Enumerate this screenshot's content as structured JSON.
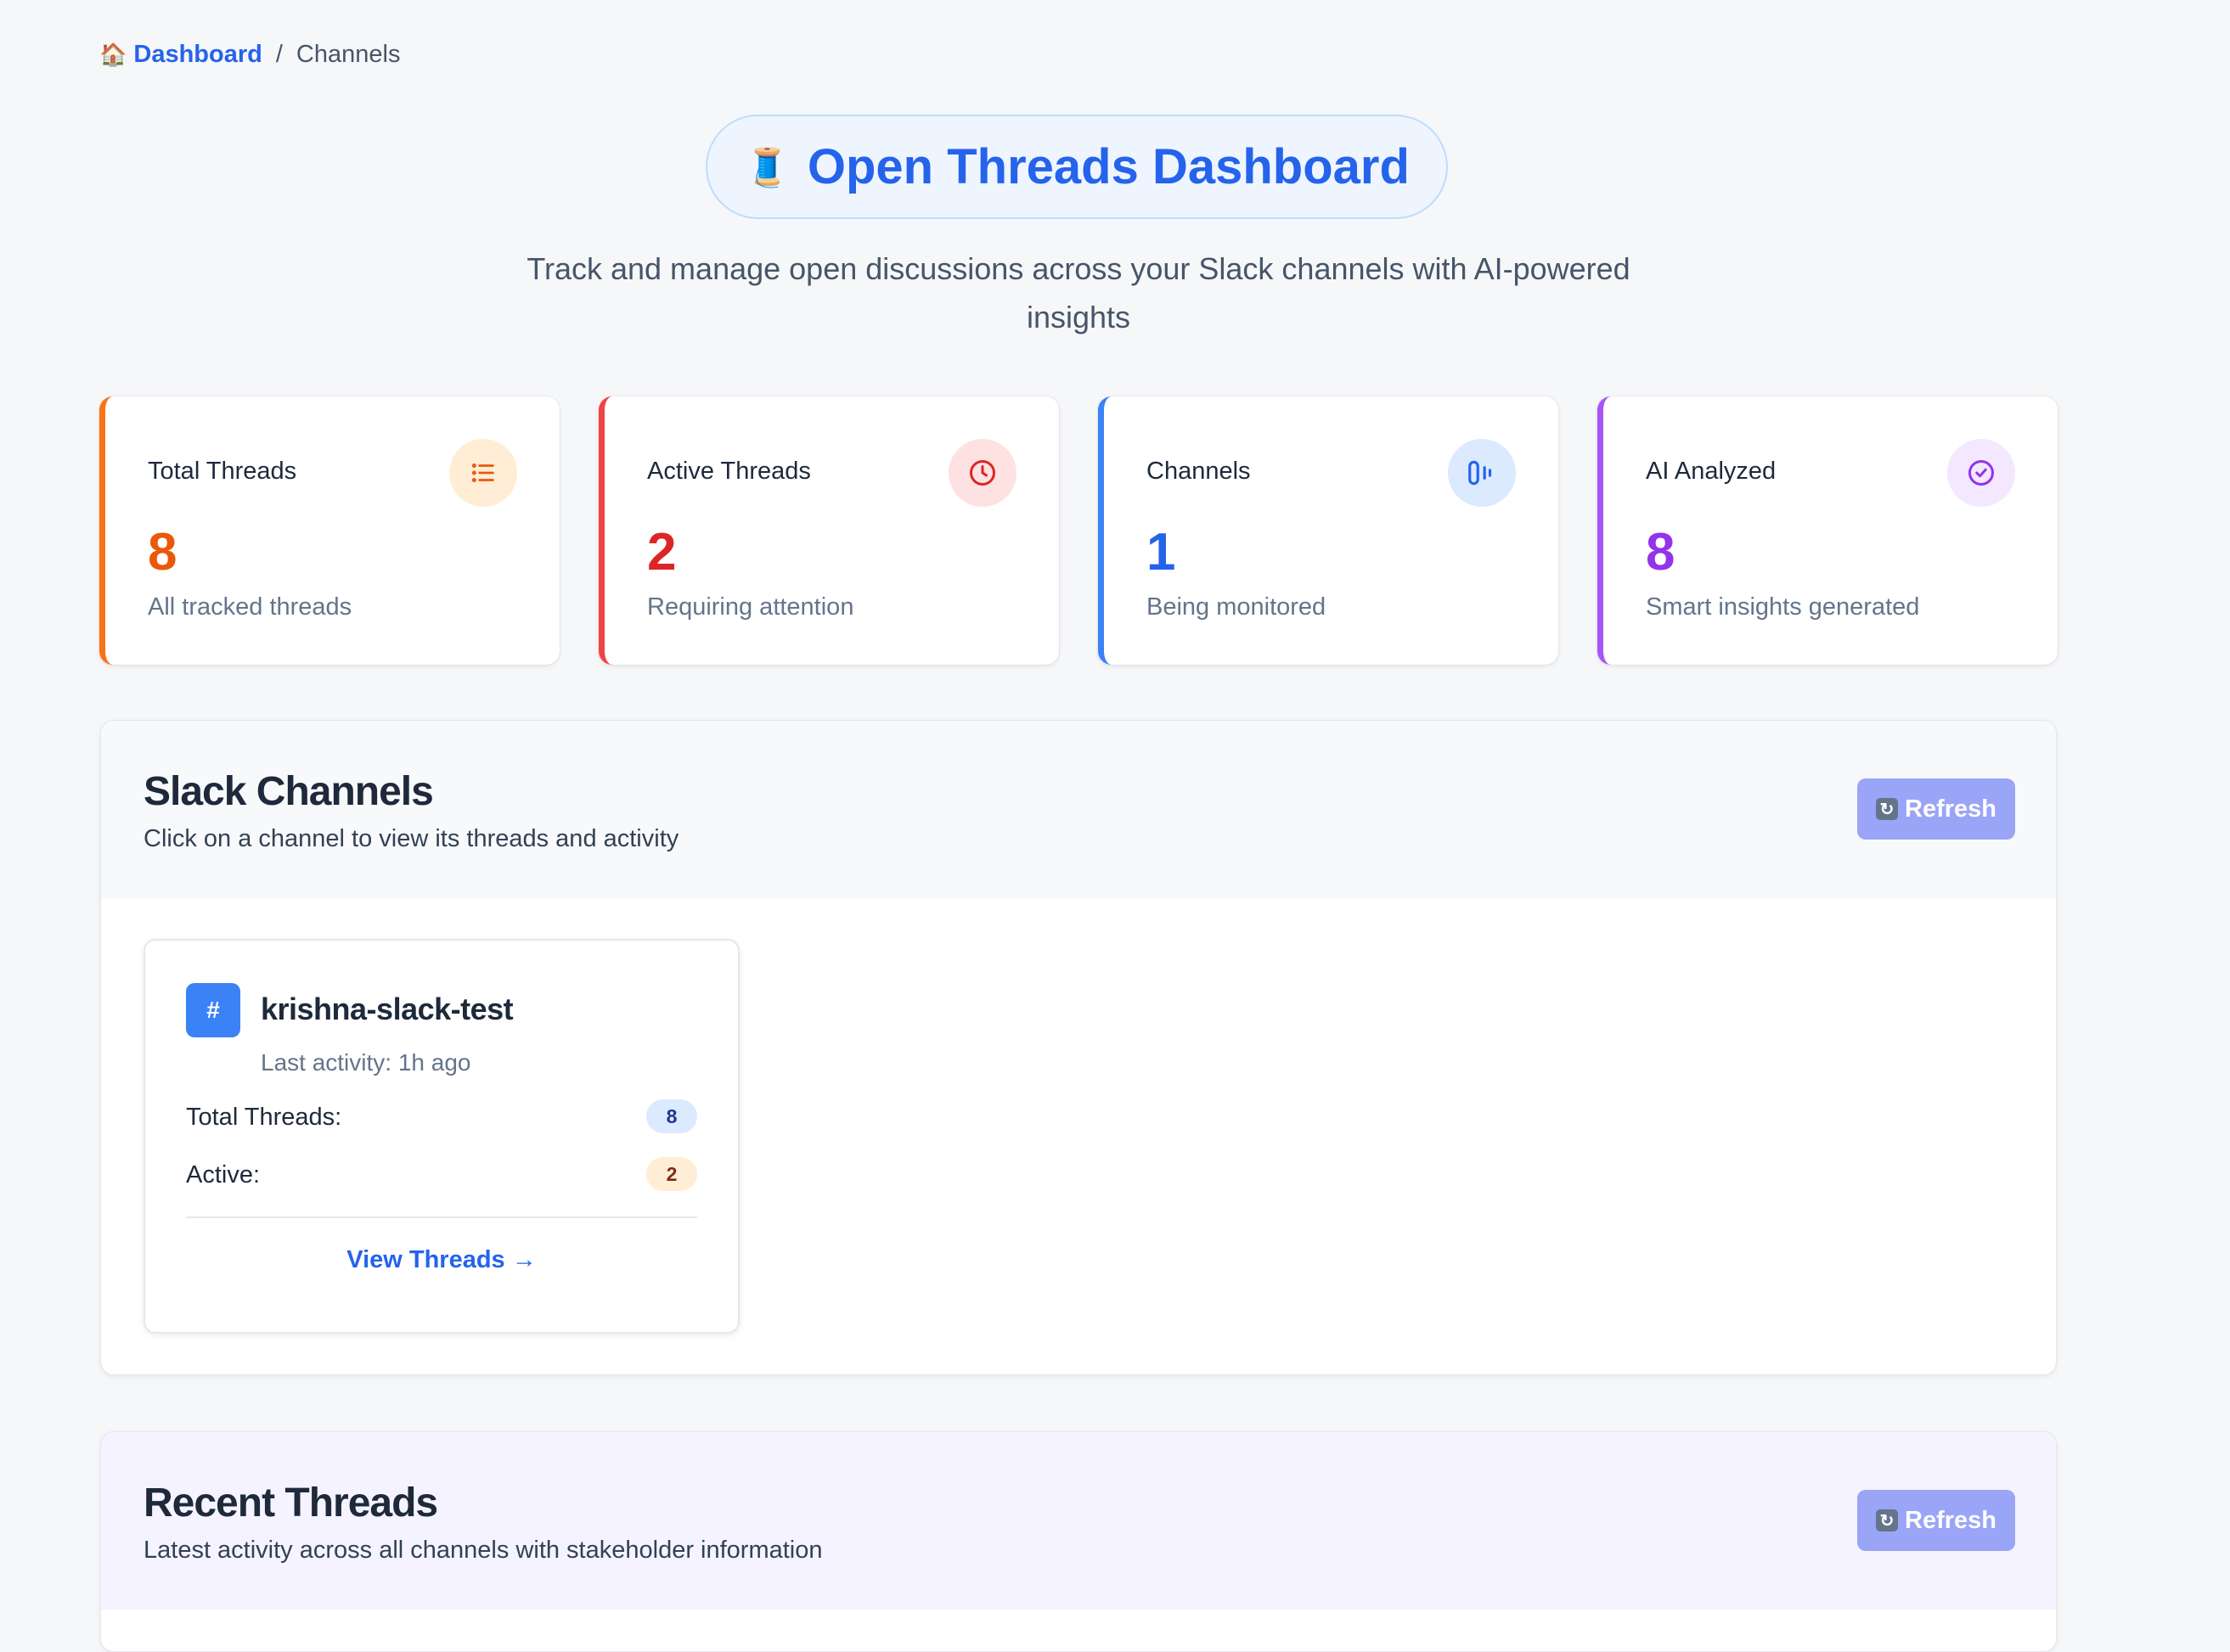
{
  "breadcrumb": {
    "home_link": "Dashboard",
    "separator": "/",
    "current": "Channels"
  },
  "header": {
    "title": "Open Threads Dashboard",
    "subtitle": "Track and manage open discussions across your Slack channels with AI-powered insights"
  },
  "stats": [
    {
      "label": "Total Threads",
      "value": "8",
      "caption": "All tracked threads",
      "icon": "list-icon",
      "color": "#ea580c"
    },
    {
      "label": "Active Threads",
      "value": "2",
      "caption": "Requiring attention",
      "icon": "clock-icon",
      "color": "#dc2626"
    },
    {
      "label": "Channels",
      "value": "1",
      "caption": "Being monitored",
      "icon": "signal-icon",
      "color": "#2563eb"
    },
    {
      "label": "AI Analyzed",
      "value": "8",
      "caption": "Smart insights generated",
      "icon": "check-circle-icon",
      "color": "#9333ea"
    }
  ],
  "channels_section": {
    "title": "Slack Channels",
    "description": "Click on a channel to view its threads and activity",
    "refresh_label": "Refresh",
    "channel": {
      "name": "krishna-slack-test",
      "last_activity": "Last activity: 1h ago",
      "total_label": "Total Threads:",
      "total_value": "8",
      "active_label": "Active:",
      "active_value": "2",
      "link": "View Threads →"
    }
  },
  "recent_section": {
    "title": "Recent Threads",
    "description": "Latest activity across all channels with stakeholder information",
    "refresh_label": "Refresh"
  }
}
